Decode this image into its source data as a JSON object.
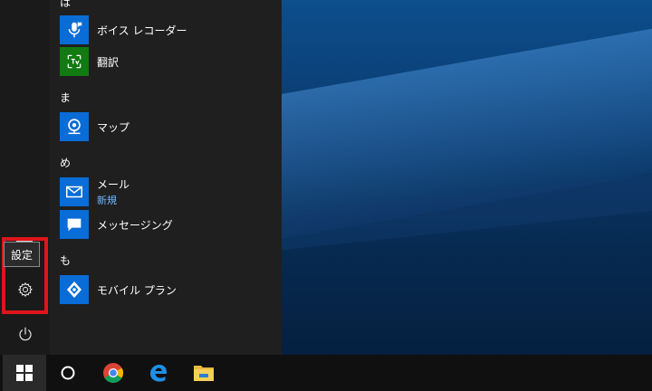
{
  "start_menu": {
    "groups": [
      {
        "letter": "は",
        "apps": [
          {
            "label": "ボイス レコーダー",
            "icon": "microphone-icon",
            "color": "#0a6cd6"
          },
          {
            "label": "翻訳",
            "icon": "translator-icon",
            "color": "#117a11"
          }
        ]
      },
      {
        "letter": "ま",
        "apps": [
          {
            "label": "マップ",
            "icon": "map-pin-icon",
            "color": "#0a6cd6"
          }
        ]
      },
      {
        "letter": "め",
        "apps": [
          {
            "label": "メール",
            "sub": "新規",
            "icon": "mail-icon",
            "color": "#0a6cd6"
          },
          {
            "label": "メッセージング",
            "icon": "chat-bubble-icon",
            "color": "#0a6cd6"
          }
        ]
      },
      {
        "letter": "も",
        "apps": [
          {
            "label": "モバイル プラン",
            "icon": "mobile-plan-icon",
            "color": "#0a6cd6"
          }
        ]
      }
    ],
    "tooltip": "設定",
    "highlight_color": "#e0141b"
  },
  "rail": {
    "settings_icon": "gear-icon",
    "power_icon": "power-icon"
  },
  "taskbar": {
    "items": [
      "windows-start-icon",
      "cortana-search-icon",
      "chrome-icon",
      "edge-icon",
      "file-explorer-icon"
    ]
  }
}
